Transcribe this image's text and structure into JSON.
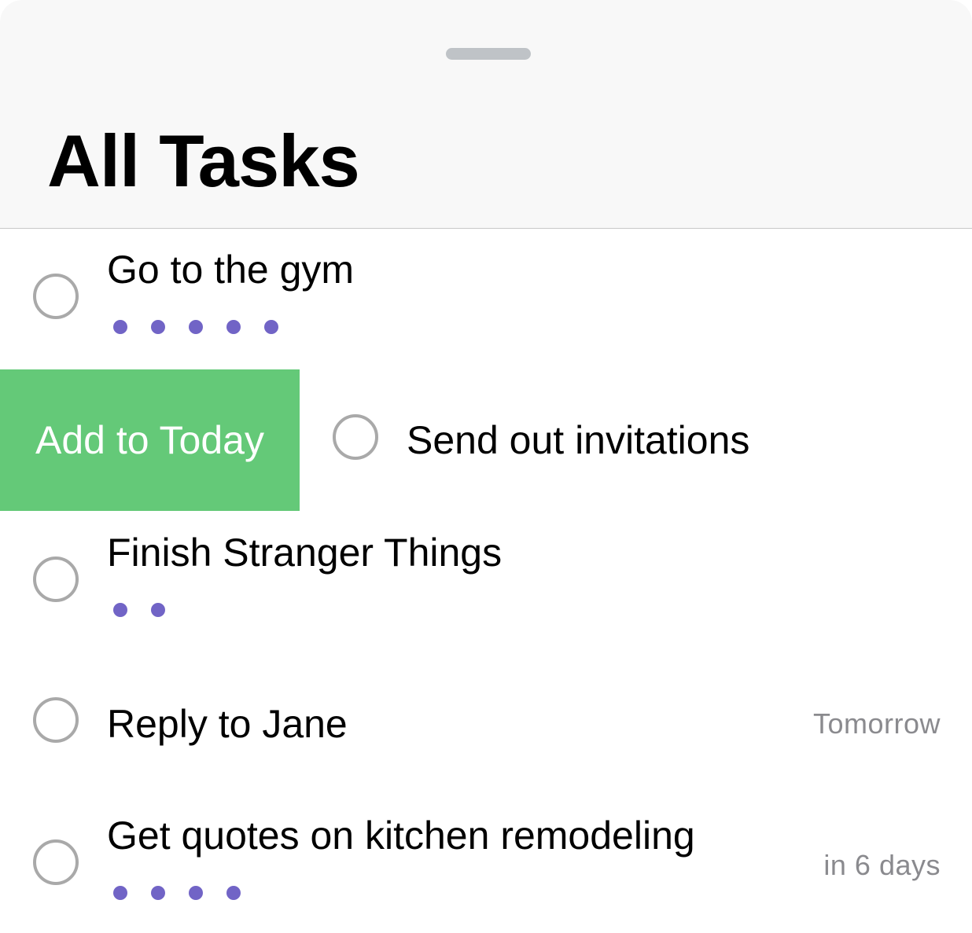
{
  "header": {
    "title": "All Tasks"
  },
  "colors": {
    "accent_dots": "#7164c6",
    "swipe_action": "#64c978",
    "circle_border": "#a9a9a9",
    "due_text": "#8a8a8e"
  },
  "swipe_action": {
    "label": "Add to Today"
  },
  "tasks": [
    {
      "title": "Go to the gym",
      "priority_dots": 5,
      "due": ""
    },
    {
      "title": "Send out invitations",
      "priority_dots": 0,
      "due": ""
    },
    {
      "title": "Finish Stranger Things",
      "priority_dots": 2,
      "due": ""
    },
    {
      "title": "Reply to Jane",
      "priority_dots": 0,
      "due": "Tomorrow"
    },
    {
      "title": "Get quotes on kitchen remodeling",
      "priority_dots": 4,
      "due": "in 6 days"
    }
  ]
}
